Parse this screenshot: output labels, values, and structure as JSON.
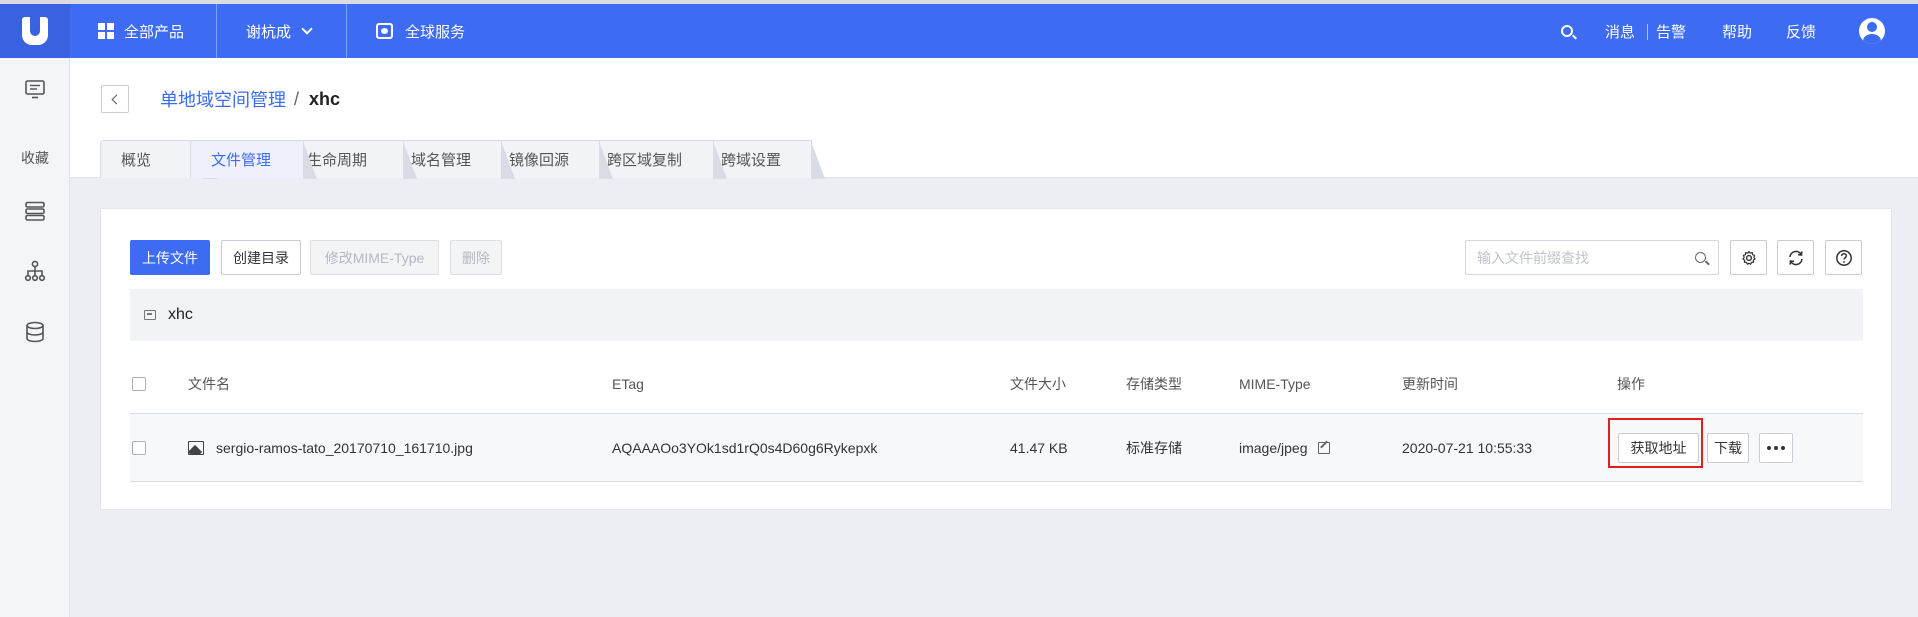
{
  "topbar": {
    "all_products": "全部产品",
    "region": "谢杭成",
    "global_service": "全球服务",
    "messages": "消息",
    "alerts": "告警",
    "help": "帮助",
    "feedback": "反馈"
  },
  "sidebar": {
    "favorites": "收藏"
  },
  "breadcrumb": {
    "parent": "单地域空间管理",
    "separator": "/",
    "current": "xhc"
  },
  "tabs": [
    {
      "label": "概览",
      "active": false
    },
    {
      "label": "文件管理",
      "active": true
    },
    {
      "label": "生命周期",
      "active": false
    },
    {
      "label": "域名管理",
      "active": false
    },
    {
      "label": "镜像回源",
      "active": false
    },
    {
      "label": "跨区域复制",
      "active": false
    },
    {
      "label": "跨域设置",
      "active": false
    }
  ],
  "toolbar": {
    "upload": "上传文件",
    "create_dir": "创建目录",
    "modify_mime": "修改MIME-Type",
    "delete": "删除",
    "search_placeholder": "输入文件前缀查找"
  },
  "path": {
    "bucket": "xhc"
  },
  "table": {
    "headers": {
      "name": "文件名",
      "etag": "ETag",
      "size": "文件大小",
      "storage": "存储类型",
      "mime": "MIME-Type",
      "updated": "更新时间",
      "actions": "操作"
    },
    "rows": [
      {
        "name": "sergio-ramos-tato_20170710_161710.jpg",
        "etag": "AQAAAOo3YOk1sd1rQ0s4D60g6Rykepxk",
        "size": "41.47 KB",
        "storage": "标准存储",
        "mime": "image/jpeg",
        "updated": "2020-07-21 10:55:33",
        "get_url": "获取地址",
        "download": "下载"
      }
    ]
  },
  "colors": {
    "primary": "#3d6cf2",
    "highlight": "#e02020"
  }
}
